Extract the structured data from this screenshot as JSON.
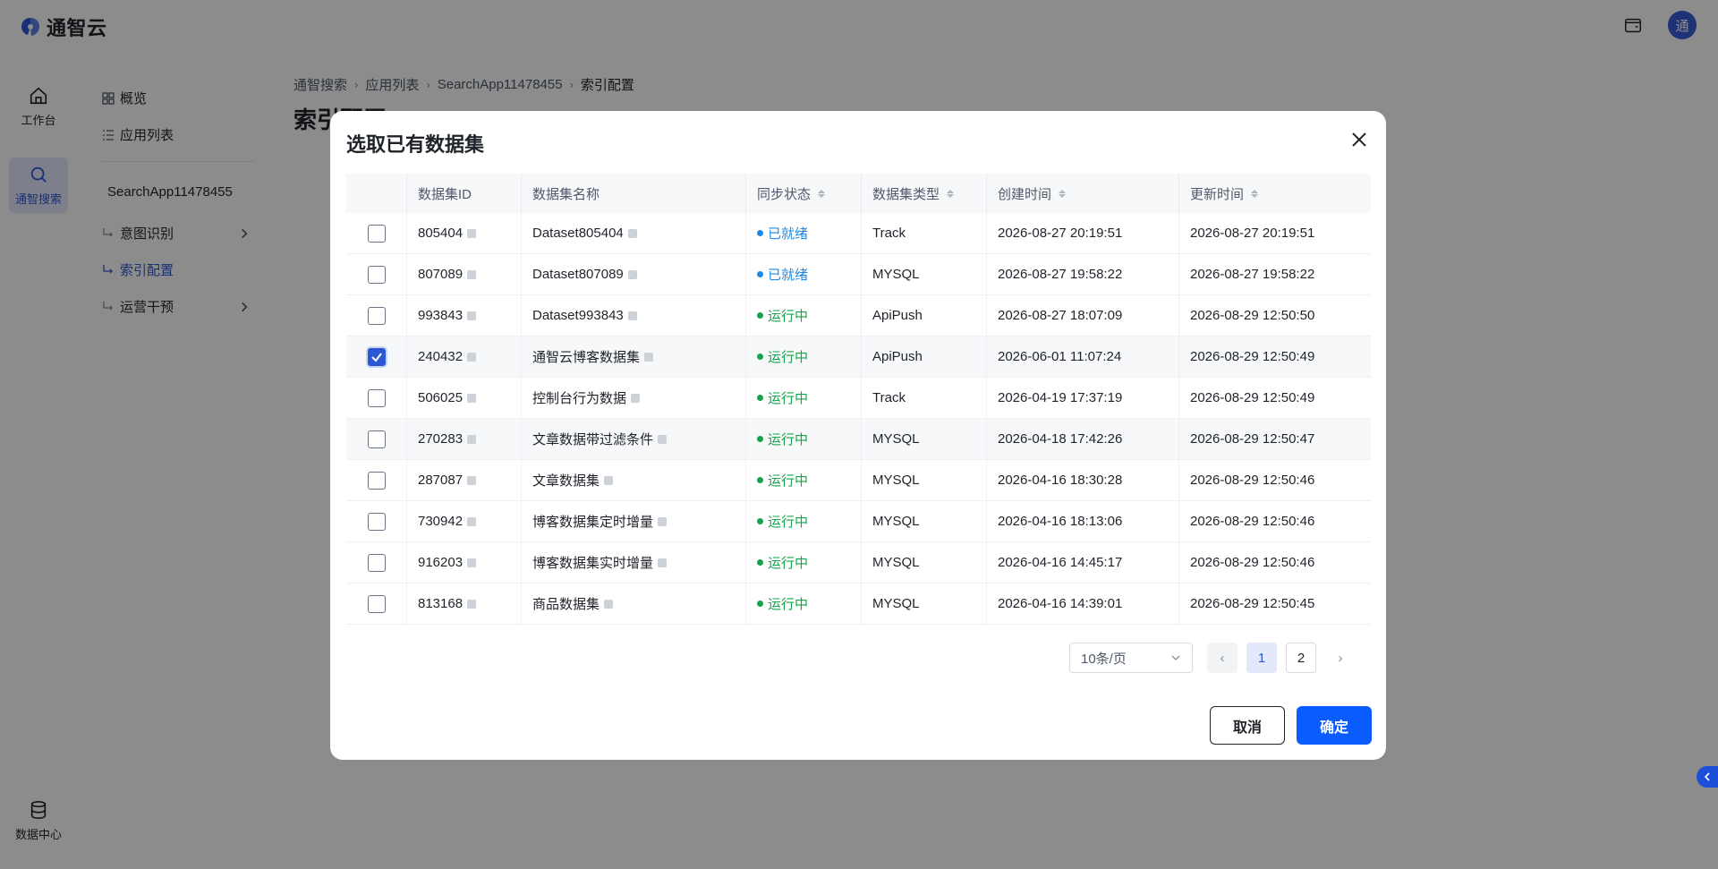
{
  "app": {
    "logo_text": "通智云",
    "avatar_text": "通"
  },
  "rail": {
    "items": [
      {
        "label": "工作台",
        "icon": "home-icon"
      },
      {
        "label": "通智搜索",
        "icon": "search-icon"
      },
      {
        "label": "数据中心",
        "icon": "database-icon"
      }
    ]
  },
  "subnav": {
    "overview": "概览",
    "app_list": "应用列表",
    "app_name": "SearchApp11478455",
    "intent": "意图识别",
    "index_config": "索引配置",
    "ops": "运营干预"
  },
  "breadcrumb": [
    "通智搜索",
    "应用列表",
    "SearchApp11478455",
    "索引配置"
  ],
  "page_title": "索引配置",
  "modal": {
    "title": "选取已有数据集",
    "columns": {
      "id": "数据集ID",
      "name": "数据集名称",
      "sync": "同步状态",
      "type": "数据集类型",
      "created": "创建时间",
      "updated": "更新时间"
    },
    "rows": [
      {
        "id": "805404",
        "name": "Dataset805404",
        "status": "已就绪",
        "type": "Track",
        "created": "2026-08-27 20:19:51",
        "updated": "2026-08-27 20:19:51",
        "checked": false
      },
      {
        "id": "807089",
        "name": "Dataset807089",
        "status": "已就绪",
        "type": "MYSQL",
        "created": "2026-08-27 19:58:22",
        "updated": "2026-08-27 19:58:22",
        "checked": false
      },
      {
        "id": "993843",
        "name": "Dataset993843",
        "status": "运行中",
        "type": "ApiPush",
        "created": "2026-08-27 18:07:09",
        "updated": "2026-08-29 12:50:50",
        "checked": false
      },
      {
        "id": "240432",
        "name": "通智云博客数据集",
        "status": "运行中",
        "type": "ApiPush",
        "created": "2026-06-01 11:07:24",
        "updated": "2026-08-29 12:50:49",
        "checked": true
      },
      {
        "id": "506025",
        "name": "控制台行为数据",
        "status": "运行中",
        "type": "Track",
        "created": "2026-04-19 17:37:19",
        "updated": "2026-08-29 12:50:49",
        "checked": false
      },
      {
        "id": "270283",
        "name": "文章数据带过滤条件",
        "status": "运行中",
        "type": "MYSQL",
        "created": "2026-04-18 17:42:26",
        "updated": "2026-08-29 12:50:47",
        "checked": false
      },
      {
        "id": "287087",
        "name": "文章数据集",
        "status": "运行中",
        "type": "MYSQL",
        "created": "2026-04-16 18:30:28",
        "updated": "2026-08-29 12:50:46",
        "checked": false
      },
      {
        "id": "730942",
        "name": "博客数据集定时增量",
        "status": "运行中",
        "type": "MYSQL",
        "created": "2026-04-16 18:13:06",
        "updated": "2026-08-29 12:50:46",
        "checked": false
      },
      {
        "id": "916203",
        "name": "博客数据集实时增量",
        "status": "运行中",
        "type": "MYSQL",
        "created": "2026-04-16 14:45:17",
        "updated": "2026-08-29 12:50:46",
        "checked": false
      },
      {
        "id": "813168",
        "name": "商品数据集",
        "status": "运行中",
        "type": "MYSQL",
        "created": "2026-04-16 14:39:01",
        "updated": "2026-08-29 12:50:45",
        "checked": false
      }
    ],
    "status_colors": {
      "已就绪": "#1e88e5",
      "运行中": "#16a34a"
    },
    "pagination": {
      "page_size": "10条/页",
      "pages": [
        "1",
        "2"
      ],
      "current": "1"
    },
    "cancel_label": "取消",
    "ok_label": "确定"
  }
}
